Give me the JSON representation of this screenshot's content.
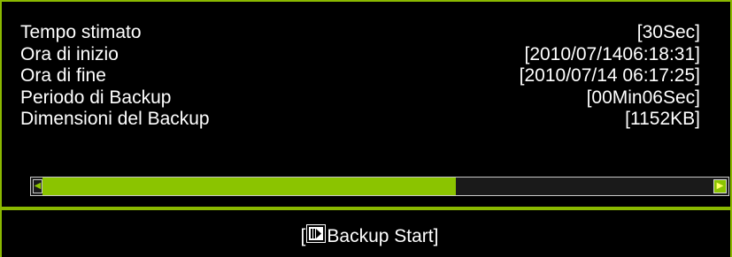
{
  "info": {
    "rows": [
      {
        "label": "Tempo stimato",
        "value": "[30Sec]"
      },
      {
        "label": "Ora di inizio",
        "value": "[2010/07/1406:18:31]"
      },
      {
        "label": "Ora di fine",
        "value": "[2010/07/14 06:17:25]"
      },
      {
        "label": "Periodo di Backup",
        "value": "[00Min06Sec]"
      },
      {
        "label": "Dimensioni del Backup",
        "value": "[1152KB]"
      }
    ]
  },
  "progress": {
    "fraction": 0.62
  },
  "action": {
    "bracket_open": "[",
    "label": "Backup Start]",
    "icon": "play-pause-icon"
  },
  "colors": {
    "accent": "#8bc400",
    "border": "#8ab800",
    "background": "#000000",
    "text": "#ffffff"
  }
}
